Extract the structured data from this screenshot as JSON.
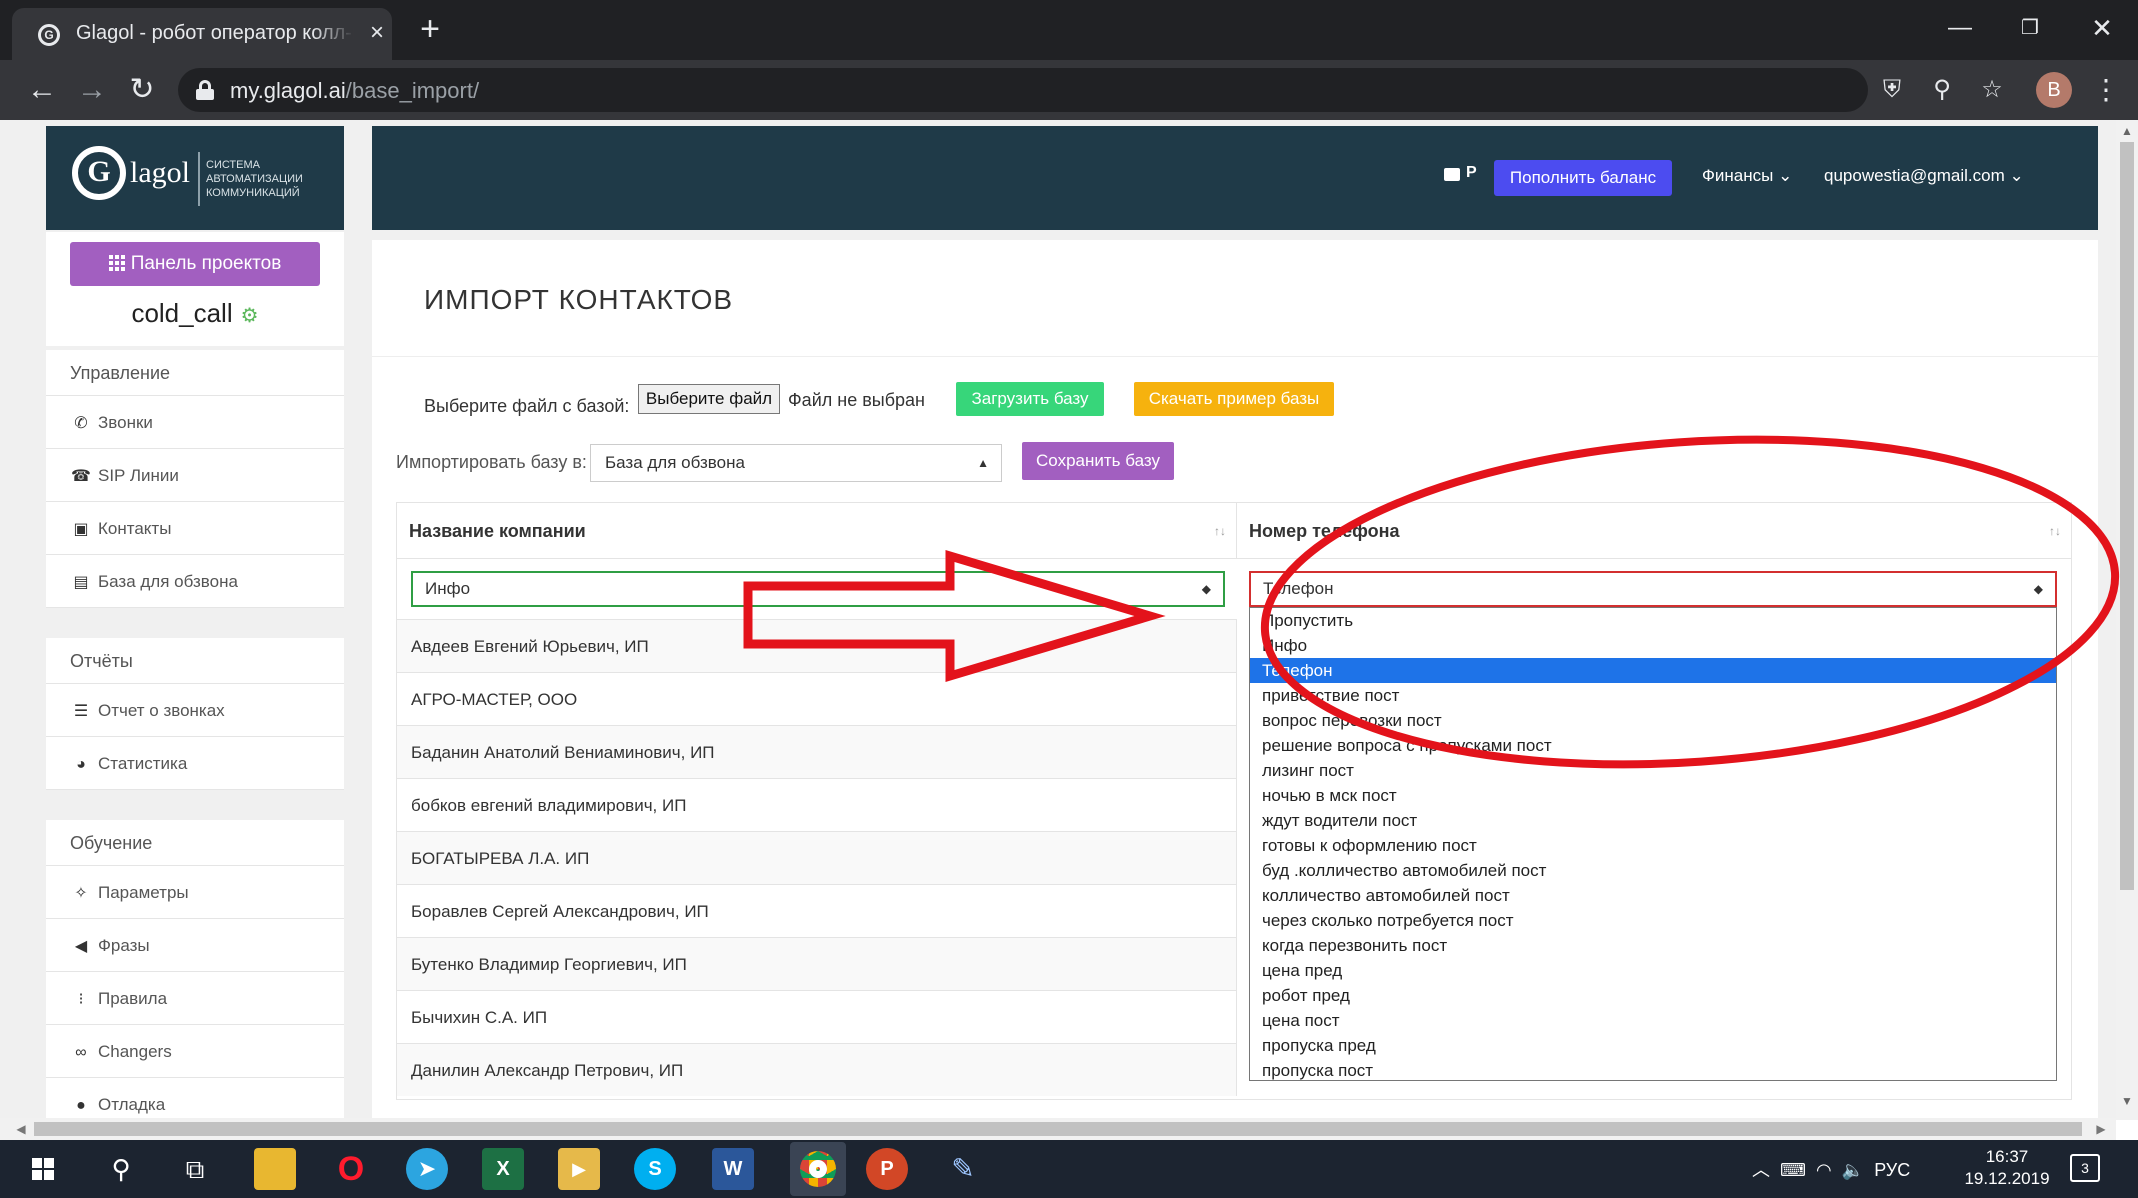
{
  "browser": {
    "tab_title": "Glagol - робот оператор колл-ц",
    "favicon_letter": "G",
    "new_tab": "+",
    "url_host": "my.glagol.ai",
    "url_path": "/base_import/",
    "profile_initial": "B"
  },
  "logo": {
    "letter": "G",
    "wordmark": "lagol",
    "tagline": [
      "СИСТЕМА",
      "АВТОМАТИЗАЦИИ",
      "КОММУНИКАЦИЙ"
    ]
  },
  "sidebar": {
    "projects_button": "Панель проектов",
    "project_name": "cold_call",
    "groups": [
      {
        "title": "Управление",
        "items": [
          {
            "label": "Звонки",
            "icon": "phone-icon"
          },
          {
            "label": "SIP Линии",
            "icon": "sip-phone-icon"
          },
          {
            "label": "Контакты",
            "icon": "address-book-icon"
          },
          {
            "label": "База для обзвона",
            "icon": "database-icon"
          }
        ]
      },
      {
        "title": "Отчёты",
        "items": [
          {
            "label": "Отчет о звонках",
            "icon": "list-icon"
          },
          {
            "label": "Статистика",
            "icon": "pie-chart-icon"
          }
        ]
      },
      {
        "title": "Обучение",
        "items": [
          {
            "label": "Параметры",
            "icon": "magic-icon"
          },
          {
            "label": "Фразы",
            "icon": "bullhorn-icon"
          },
          {
            "label": "Правила",
            "icon": "dots-list-icon"
          },
          {
            "label": "Changers",
            "icon": "link-icon"
          },
          {
            "label": "Отладка",
            "icon": "pin-icon"
          }
        ]
      }
    ]
  },
  "header": {
    "currency": "Р",
    "topup_button": "Пополнить баланс",
    "finance_menu": "Финансы",
    "user_email": "qupowestia@gmail.com"
  },
  "main": {
    "title": "ИМПОРТ КОНТАКТОВ",
    "file_label": "Выберите файл с базой:",
    "choose_file_button": "Выберите файл",
    "no_file_text": "Файл не выбран",
    "upload_button": "Загрузить базу",
    "sample_button": "Скачать пример базы",
    "import_label": "Импортировать базу в:",
    "import_target": "База для обзвона",
    "save_button": "Сохранить базу",
    "table": {
      "columns": [
        "Название компании",
        "Номер телефона"
      ],
      "company_mapping": "Инфо",
      "phone_mapping": "Телефон",
      "rows": [
        "Авдеев Евгений Юрьевич, ИП",
        "АГРО-МАСТЕР, ООО",
        "Баданин Анатолий Вениаминович, ИП",
        "бобков евгений владимирович, ИП",
        "БОГАТЫРЕВА Л.А. ИП",
        "Боравлев Сергей Александрович, ИП",
        "Бутенко Владимир Георгиевич, ИП",
        "Бычихин С.А. ИП",
        "Данилин Александр Петрович, ИП"
      ]
    },
    "dropdown": {
      "selected": "Телефон",
      "options": [
        "Пропустить",
        "Инфо",
        "Телефон",
        "приветствие пост",
        "вопрос перевозки пост",
        "решение вопроса с пропусками пост",
        "лизинг пост",
        "ночью в мск пост",
        "ждут водители пост",
        "готовы к оформлению пост",
        "буд .колличество автомобилей пост",
        "колличество автомобилей пост",
        "через сколько потребуется пост",
        "когда перезвонить пост",
        "цена пред",
        "робот пред",
        "цена пост",
        "пропуска пред",
        "пропуска пост"
      ]
    }
  },
  "taskbar": {
    "apps": [
      "X",
      "S",
      "W",
      "P"
    ],
    "tray": "РУС",
    "time": "16:37",
    "date": "19.12.2019",
    "notifications": "3"
  },
  "colors": {
    "header_bg": "#1f3a48",
    "purple": "#a25fc0",
    "blue_button": "#4c4cf0",
    "green_button": "#37d67a",
    "orange_button": "#f6b20e",
    "annotation_red": "#e3131b",
    "selection_blue": "#1e73e8"
  }
}
